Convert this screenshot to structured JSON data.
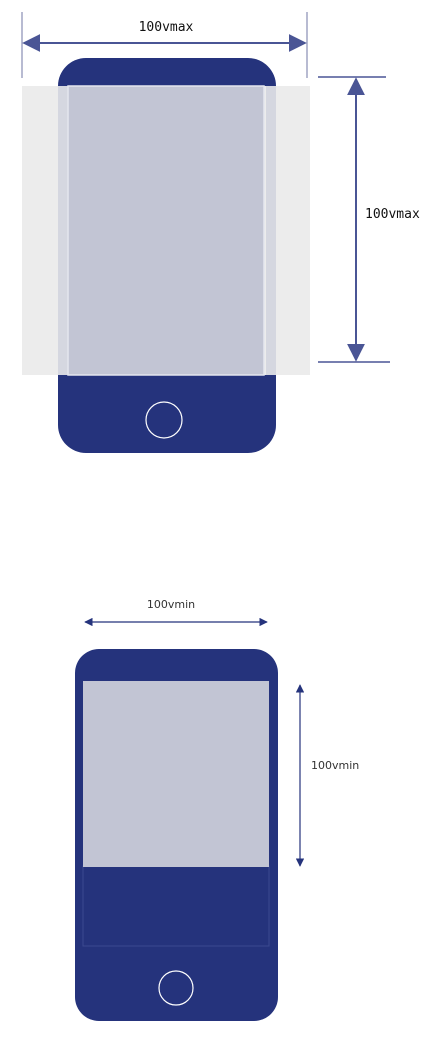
{
  "diagrams": [
    {
      "width_label": "100vmax",
      "height_label": "100vmax"
    },
    {
      "width_label": "100vmin",
      "height_label": "100vmin"
    }
  ],
  "colors": {
    "phone_body": "#25337c",
    "screen_fill": "#c2c5d4",
    "overflow_fill": "#ececec",
    "dimension_line": "#4a5595",
    "dimension_line_light": "#7077a6"
  }
}
